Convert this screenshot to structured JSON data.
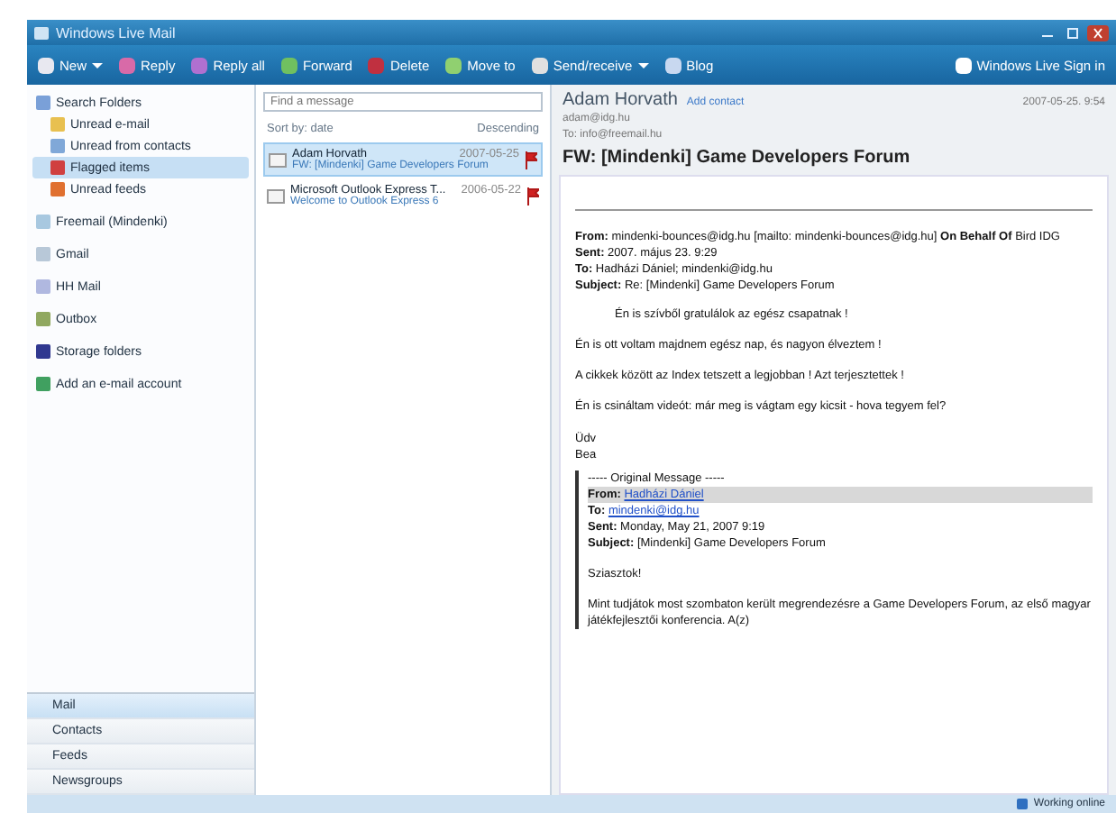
{
  "window": {
    "title": "Windows Live Mail"
  },
  "toolbar": {
    "buttons": [
      {
        "label": "New",
        "caret": true,
        "color": "#e8e8f0"
      },
      {
        "label": "Reply",
        "caret": false,
        "color": "#d86aa8"
      },
      {
        "label": "Reply all",
        "caret": false,
        "color": "#b070d0"
      },
      {
        "label": "Forward",
        "caret": false,
        "color": "#70c060"
      },
      {
        "label": "Delete",
        "caret": false,
        "color": "#c03040"
      },
      {
        "label": "Move to",
        "caret": false,
        "color": "#90d070"
      },
      {
        "label": "Send/receive",
        "caret": true,
        "color": "#e0e0e0"
      },
      {
        "label": "Blog",
        "caret": false,
        "color": "#c8d8f0"
      }
    ],
    "signin": "Windows Live Sign in"
  },
  "folders": [
    {
      "label": "Search Folders",
      "selected": false,
      "color": "#7aa0d8",
      "children": [
        {
          "label": "Unread e-mail",
          "selected": false,
          "color": "#e8c050"
        },
        {
          "label": "Unread from contacts",
          "selected": false,
          "color": "#80a8d8"
        },
        {
          "label": "Flagged items",
          "selected": true,
          "color": "#d04040"
        },
        {
          "label": "Unread feeds",
          "selected": false,
          "color": "#e07030"
        }
      ]
    },
    {
      "label": "Freemail (Mindenki)",
      "selected": false,
      "color": "#a8c8e0"
    },
    {
      "label": "Gmail",
      "selected": false,
      "color": "#b8c8d8"
    },
    {
      "label": "HH Mail",
      "selected": false,
      "color": "#b0b8e0"
    },
    {
      "label": "Outbox",
      "selected": false,
      "color": "#90a860"
    },
    {
      "label": "Storage folders",
      "selected": false,
      "color": "#303890"
    },
    {
      "label": "Add an e-mail account",
      "selected": false,
      "color": "#40a060"
    }
  ],
  "nav": [
    {
      "label": "Mail",
      "selected": true
    },
    {
      "label": "Contacts",
      "selected": false
    },
    {
      "label": "Feeds",
      "selected": false
    },
    {
      "label": "Newsgroups",
      "selected": false
    }
  ],
  "message_list": {
    "search": {
      "placeholder": "Find a message"
    },
    "sort": "Sort by: date",
    "order": "Descending",
    "messages": [
      {
        "from": "Adam Horvath",
        "date": "2007-05-25",
        "subject": "FW: [Mindenki] Game Developers Forum",
        "selected": true,
        "flagged": true
      },
      {
        "from": "Microsoft Outlook Express T...",
        "date": "2006-05-22",
        "subject": "Welcome to Outlook Express 6",
        "selected": false,
        "flagged": true
      }
    ]
  },
  "reading": {
    "sender": "Adam Horvath",
    "add_contact": "Add contact",
    "address": "adam@idg.hu",
    "to": "To: info@freemail.hu",
    "date": "2007-05-25. 9:54",
    "subject": "FW: [Mindenki] Game Developers Forum",
    "header_lines": [
      "**From:** mindenki-bounces@idg.hu [mailto: mindenki-bounces@idg.hu] **On Behalf Of** Bird IDG",
      "**Sent:** 2007. május 23. 9:29",
      "**To:** Hadházi Dániel; mindenki@idg.hu",
      "**Subject:** Re: [Mindenki] Game Developers Forum"
    ],
    "greeting": "Én is szívből gratulálok az egész csapatnak !",
    "paragraphs": [
      "Én is ott voltam majdnem egész nap, és nagyon élveztem !",
      "A cikkek között az Index tetszett a legjobban ! Azt terjesztettek !",
      "Én is csináltam videót: már meg is vágtam egy kicsit - hova tegyem fel?"
    ],
    "signoff": [
      "Üdv",
      "Bea"
    ],
    "original": {
      "title": "----- Original Message -----",
      "from_label": "From:",
      "from": "Hadházi Dániel",
      "to_label": "To:",
      "to": "mindenki@idg.hu",
      "sent": "**Sent:** Monday, May 21, 2007 9:19",
      "subject": "**Subject:** [Mindenki] Game Developers Forum",
      "greeting": "Sziasztok!",
      "text": "Mint tudjátok most szombaton került megrendezésre a Game Developers Forum, az első magyar játékfejlesztői konferencia. A(z)"
    }
  },
  "status_bar": {
    "state": "Working online"
  }
}
